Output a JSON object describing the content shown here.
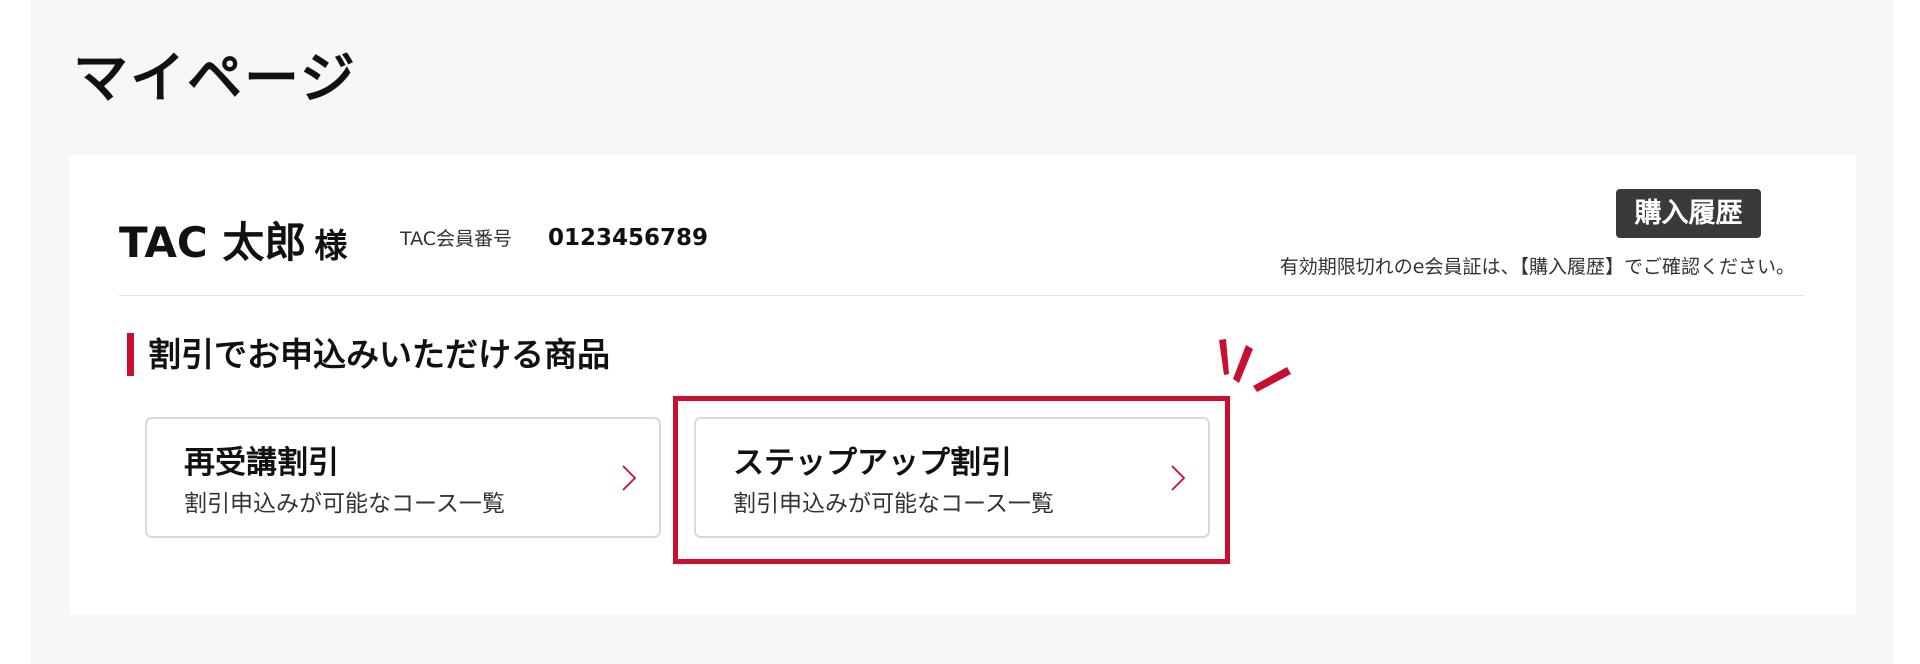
{
  "page": {
    "title": "マイページ"
  },
  "user": {
    "name": "TAC 太郎",
    "honorific": "様",
    "member_label": "TAC会員番号",
    "member_number": "0123456789"
  },
  "history": {
    "button_label": "購入履歴",
    "note": "有効期限切れのe会員証は、【購入履歴】でご確認ください。"
  },
  "section": {
    "title": "割引でお申込みいただける商品"
  },
  "discounts": [
    {
      "title": "再受講割引",
      "subtitle": "割引申込みが可能なコース一覧"
    },
    {
      "title": "ステップアップ割引",
      "subtitle": "割引申込みが可能なコース一覧"
    }
  ],
  "colors": {
    "accent": "#c8102e",
    "button_bg": "#3a3a3a",
    "page_bg": "#f7f7f7",
    "card_bg": "#ffffff"
  },
  "icons": {
    "card_arrow": "chevron-right-icon",
    "highlight": "emphasis-burst-icon"
  }
}
